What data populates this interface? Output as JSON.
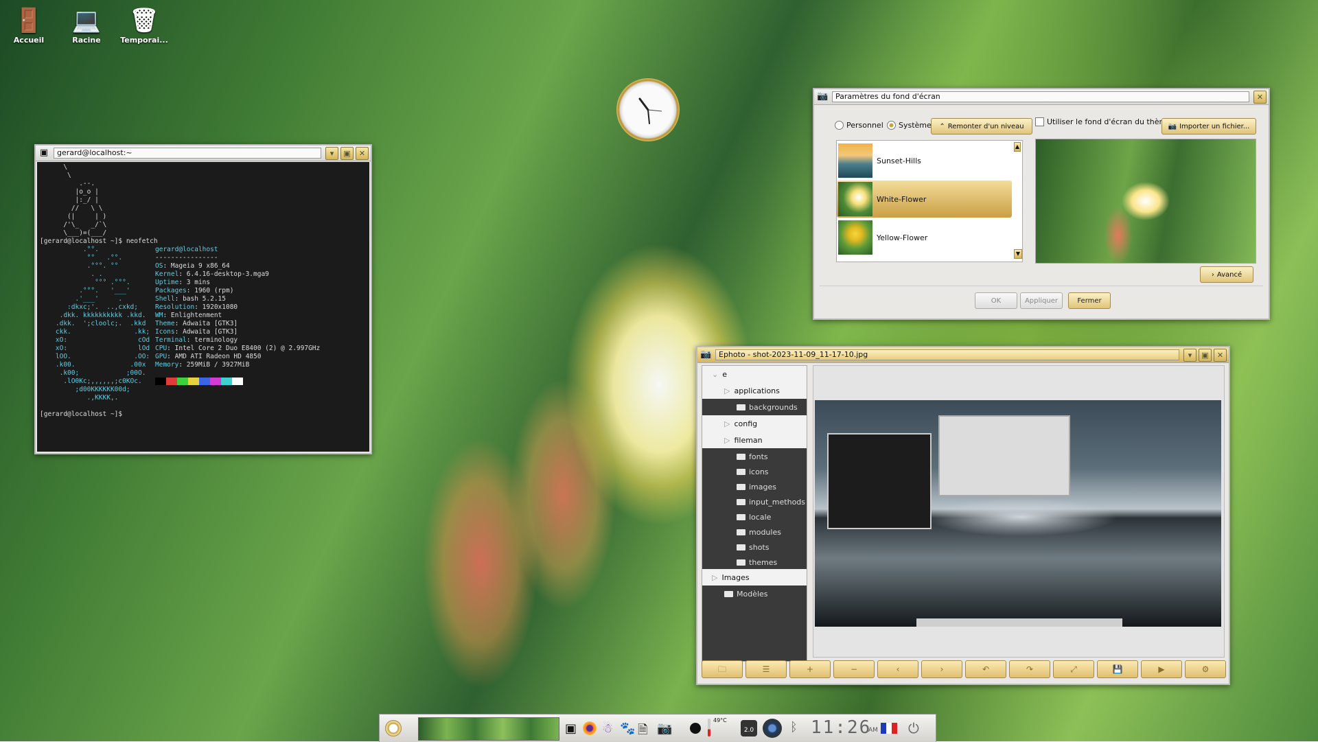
{
  "desktop": {
    "icons": [
      {
        "label": "Accueil",
        "icon": "home-icon"
      },
      {
        "label": "Racine",
        "icon": "computer-icon"
      },
      {
        "label": "Temporai...",
        "icon": "trash-icon"
      }
    ]
  },
  "terminal": {
    "title": "gerard@localhost:~",
    "prompt1": "[gerard@localhost ~]$ neofetch",
    "prompt2": "[gerard@localhost ~]$",
    "user_host": "gerard@localhost",
    "separator": "----------------",
    "info": [
      {
        "key": "OS",
        "value": "Mageia 9 x86_64"
      },
      {
        "key": "Kernel",
        "value": "6.4.16-desktop-3.mga9"
      },
      {
        "key": "Uptime",
        "value": "3 mins"
      },
      {
        "key": "Packages",
        "value": "1960 (rpm)"
      },
      {
        "key": "Shell",
        "value": "bash 5.2.15"
      },
      {
        "key": "Resolution",
        "value": "1920x1080"
      },
      {
        "key": "WM",
        "value": "Enlightenment"
      },
      {
        "key": "Theme",
        "value": "Adwaita [GTK3]"
      },
      {
        "key": "Icons",
        "value": "Adwaita [GTK3]"
      },
      {
        "key": "Terminal",
        "value": "terminology"
      },
      {
        "key": "CPU",
        "value": "Intel Core 2 Duo E8400 (2) @ 2.997GHz"
      },
      {
        "key": "GPU",
        "value": "AMD ATI Radeon HD 4850"
      },
      {
        "key": "Memory",
        "value": "259MiB / 3927MiB"
      }
    ],
    "palette": [
      "#000000",
      "#e03c3c",
      "#3cd23c",
      "#e6d23c",
      "#3c64e6",
      "#d23cd2",
      "#3cd2d2",
      "#ffffff"
    ]
  },
  "wallpaper_dialog": {
    "title": "Paramètres du fond d'écran",
    "radio_personal": "Personnel",
    "radio_system": "Système",
    "up_button": "Remonter d'un niveau",
    "use_theme_checkbox": "Utiliser le fond d'écran du thème",
    "import_button": "Importer un fichier...",
    "items": [
      {
        "name": "Sunset-Hills",
        "selected": false
      },
      {
        "name": "White-Flower",
        "selected": true
      },
      {
        "name": "Yellow-Flower",
        "selected": false
      }
    ],
    "advanced_button": "Avancé",
    "ok_button": "OK",
    "apply_button": "Appliquer",
    "close_button": "Fermer"
  },
  "ephoto": {
    "title": "Ephoto - shot-2023-11-09_11-17-10.jpg",
    "tree": [
      {
        "label": "e",
        "style": "light",
        "indent": 0,
        "type": "expanded"
      },
      {
        "label": "applications",
        "style": "light",
        "indent": 1,
        "type": "collapsed"
      },
      {
        "label": "backgrounds",
        "style": "dark",
        "indent": 2,
        "type": "folder"
      },
      {
        "label": "config",
        "style": "light",
        "indent": 1,
        "type": "collapsed"
      },
      {
        "label": "fileman",
        "style": "light",
        "indent": 1,
        "type": "collapsed"
      },
      {
        "label": "fonts",
        "style": "dark",
        "indent": 2,
        "type": "folder"
      },
      {
        "label": "icons",
        "style": "dark",
        "indent": 2,
        "type": "folder"
      },
      {
        "label": "images",
        "style": "dark",
        "indent": 2,
        "type": "folder"
      },
      {
        "label": "input_methods",
        "style": "dark",
        "indent": 2,
        "type": "folder"
      },
      {
        "label": "locale",
        "style": "dark",
        "indent": 2,
        "type": "folder"
      },
      {
        "label": "modules",
        "style": "dark",
        "indent": 2,
        "type": "folder"
      },
      {
        "label": "shots",
        "style": "dark",
        "indent": 2,
        "type": "folder"
      },
      {
        "label": "themes",
        "style": "dark",
        "indent": 2,
        "type": "folder"
      },
      {
        "label": "Images",
        "style": "light",
        "indent": 0,
        "type": "collapsed"
      },
      {
        "label": "Modèles",
        "style": "dark",
        "indent": 1,
        "type": "folder"
      }
    ],
    "toolbar": [
      "folder-icon",
      "list-icon",
      "zoom-in-icon",
      "zoom-out-icon",
      "previous-icon",
      "next-icon",
      "rotate-left-icon",
      "rotate-right-icon",
      "fullscreen-icon",
      "save-icon",
      "slideshow-icon",
      "settings-icon"
    ]
  },
  "clock": {
    "label": "analog-clock"
  },
  "taskbar": {
    "temperature": "49°C",
    "cpu_freq": "2.0",
    "time": "11:26",
    "ampm": "AM",
    "items": [
      "start-icon",
      "pager-icon",
      "terminal-icon",
      "firefox-icon",
      "ghost-icon",
      "gimp-icon",
      "document-icon",
      "camera-icon",
      "record-icon",
      "thermometer-icon",
      "cpufreq-icon",
      "volume-icon",
      "bluetooth-icon",
      "flag-icon",
      "power-icon"
    ]
  }
}
